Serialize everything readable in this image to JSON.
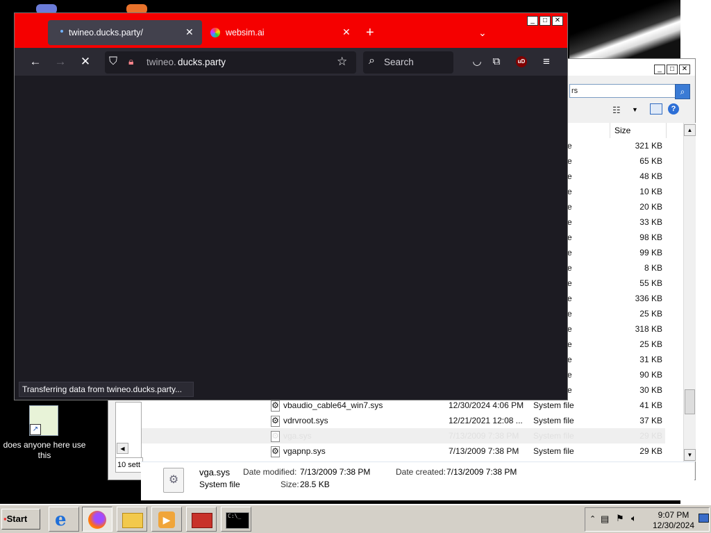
{
  "browser": {
    "tabs": [
      {
        "label": "twineo.ducks.party/",
        "active": true
      },
      {
        "label": "websim.ai",
        "active": false
      }
    ],
    "url_domain_prefix": "twineo.",
    "url_domain_main": "ducks.party",
    "search_placeholder": "Search",
    "status_text": "Transferring data from twineo.ducks.party...",
    "win_buttons": {
      "minimize": "_",
      "maximize": "□",
      "close": "✕"
    },
    "colors": {
      "tab_bar": "#f50000",
      "toolbar": "#2b2a33",
      "content": "#1c1b22"
    }
  },
  "explorer": {
    "search_value": "rs",
    "column_size": "Size",
    "rows": [
      {
        "trunc": "e",
        "size": "321 KB"
      },
      {
        "trunc": "e",
        "size": "65 KB"
      },
      {
        "trunc": "e",
        "size": "48 KB"
      },
      {
        "trunc": "e",
        "size": "10 KB"
      },
      {
        "trunc": "e",
        "size": "20 KB"
      },
      {
        "trunc": "e",
        "size": "33 KB"
      },
      {
        "trunc": "e",
        "size": "98 KB"
      },
      {
        "trunc": "e",
        "size": "99 KB"
      },
      {
        "trunc": "e",
        "size": "8 KB"
      },
      {
        "trunc": "e",
        "size": "55 KB"
      },
      {
        "trunc": "e",
        "size": "336 KB"
      },
      {
        "trunc": "e",
        "size": "25 KB"
      },
      {
        "trunc": "e",
        "size": "318 KB"
      },
      {
        "trunc": "e",
        "size": "25 KB"
      },
      {
        "trunc": "e",
        "size": "31 KB"
      },
      {
        "trunc": "e",
        "size": "90 KB"
      },
      {
        "trunc": "e",
        "size": "30 KB"
      }
    ],
    "full_rows": [
      {
        "name": "vbaudio_cable64_win7.sys",
        "date": "12/30/2024 4:06 PM",
        "type": "System file",
        "size": "41 KB",
        "selected": false
      },
      {
        "name": "vdrvroot.sys",
        "date": "12/21/2021 12:08 ...",
        "type": "System file",
        "size": "37 KB",
        "selected": false
      },
      {
        "name": "vga.sys",
        "date": "7/13/2009 7:38 PM",
        "type": "System file",
        "size": "29 KB",
        "selected": true
      },
      {
        "name": "vgapnp.sys",
        "date": "7/13/2009 7:38 PM",
        "type": "System file",
        "size": "29 KB",
        "selected": false
      }
    ],
    "left_status": "10 sett",
    "details": {
      "name": "vga.sys",
      "type": "System file",
      "date_modified_label": "Date modified:",
      "date_modified": "7/13/2009 7:38 PM",
      "size_label": "Size:",
      "size": "28.5 KB",
      "date_created_label": "Date created:",
      "date_created": "7/13/2009 7:38 PM"
    }
  },
  "desktop": {
    "shortcut_label": "does anyone here use this"
  },
  "taskbar": {
    "start_label": "Start",
    "apps": [
      "internet-explorer",
      "firefox",
      "file-explorer",
      "media-player",
      "toolbox",
      "command-prompt"
    ],
    "clock_time": "9:07 PM",
    "clock_date": "12/30/2024"
  }
}
